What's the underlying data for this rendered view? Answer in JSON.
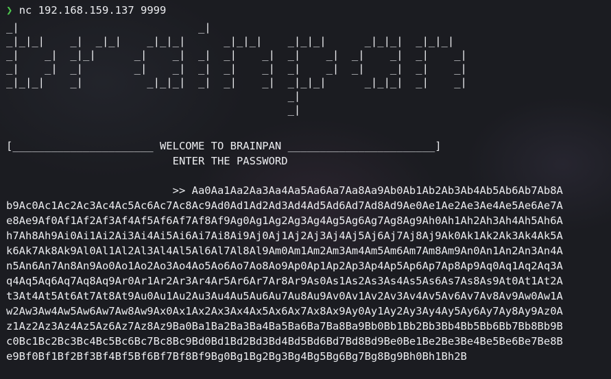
{
  "terminal": {
    "prompt_symbol": "❯",
    "command": "nc 192.168.159.137 9999",
    "banner_art": [
      "_|                            _|",
      "_|_|_|    _|  _|_|    _|_|_|      _|_|_|    _|_|_|      _|_|_|  _|_|_|",
      "_|    _|  _|_|      _|    _|  _|  _|    _|  _|    _|  _|    _|  _|    _|",
      "_|    _|  _|        _|    _|  _|  _|    _|  _|    _|  _|    _|  _|    _|",
      "_|_|_|    _|          _|_|_|  _|  _|    _|  _|_|_|      _|_|_|  _|    _|",
      "                                            _|",
      "                                            _|"
    ],
    "welcome_line": "[______________________ WELCOME TO BRAINPAN _______________________]",
    "password_prompt": "                          ENTER THE PASSWORD",
    "input_lines": [
      "                          >> Aa0Aa1Aa2Aa3Aa4Aa5Aa6Aa7Aa8Aa9Ab0Ab1Ab2Ab3Ab4Ab5Ab6Ab7Ab8A",
      "b9Ac0Ac1Ac2Ac3Ac4Ac5Ac6Ac7Ac8Ac9Ad0Ad1Ad2Ad3Ad4Ad5Ad6Ad7Ad8Ad9Ae0Ae1Ae2Ae3Ae4Ae5Ae6Ae7A",
      "e8Ae9Af0Af1Af2Af3Af4Af5Af6Af7Af8Af9Ag0Ag1Ag2Ag3Ag4Ag5Ag6Ag7Ag8Ag9Ah0Ah1Ah2Ah3Ah4Ah5Ah6A",
      "h7Ah8Ah9Ai0Ai1Ai2Ai3Ai4Ai5Ai6Ai7Ai8Ai9Aj0Aj1Aj2Aj3Aj4Aj5Aj6Aj7Aj8Aj9Ak0Ak1Ak2Ak3Ak4Ak5A",
      "k6Ak7Ak8Ak9Al0Al1Al2Al3Al4Al5Al6Al7Al8Al9Am0Am1Am2Am3Am4Am5Am6Am7Am8Am9An0An1An2An3An4A",
      "n5An6An7An8An9Ao0Ao1Ao2Ao3Ao4Ao5Ao6Ao7Ao8Ao9Ap0Ap1Ap2Ap3Ap4Ap5Ap6Ap7Ap8Ap9Aq0Aq1Aq2Aq3A",
      "q4Aq5Aq6Aq7Aq8Aq9Ar0Ar1Ar2Ar3Ar4Ar5Ar6Ar7Ar8Ar9As0As1As2As3As4As5As6As7As8As9At0At1At2A",
      "t3At4At5At6At7At8At9Au0Au1Au2Au3Au4Au5Au6Au7Au8Au9Av0Av1Av2Av3Av4Av5Av6Av7Av8Av9Aw0Aw1A",
      "w2Aw3Aw4Aw5Aw6Aw7Aw8Aw9Ax0Ax1Ax2Ax3Ax4Ax5Ax6Ax7Ax8Ax9Ay0Ay1Ay2Ay3Ay4Ay5Ay6Ay7Ay8Ay9Az0A",
      "z1Az2Az3Az4Az5Az6Az7Az8Az9Ba0Ba1Ba2Ba3Ba4Ba5Ba6Ba7Ba8Ba9Bb0Bb1Bb2Bb3Bb4Bb5Bb6Bb7Bb8Bb9B",
      "c0Bc1Bc2Bc3Bc4Bc5Bc6Bc7Bc8Bc9Bd0Bd1Bd2Bd3Bd4Bd5Bd6Bd7Bd8Bd9Be0Be1Be2Be3Be4Be5Be6Be7Be8B",
      "e9Bf0Bf1Bf2Bf3Bf4Bf5Bf6Bf7Bf8Bf9Bg0Bg1Bg2Bg3Bg4Bg5Bg6Bg7Bg8Bg9Bh0Bh1Bh2B"
    ],
    "colors": {
      "prompt": "#4ec94e",
      "text": "#ecedf0",
      "background": "#1b1c21"
    }
  }
}
